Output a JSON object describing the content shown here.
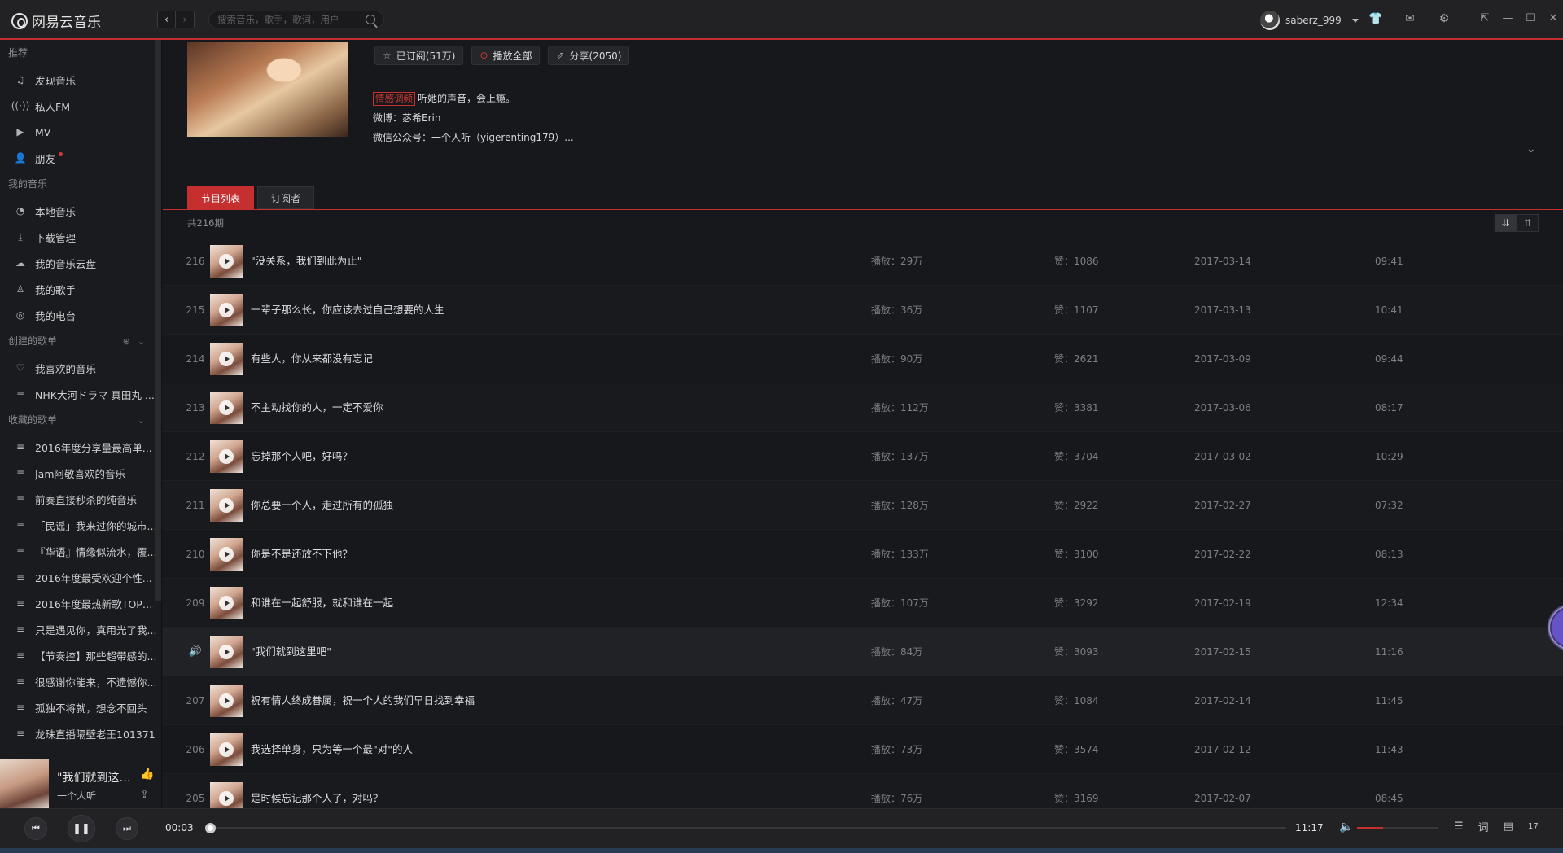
{
  "app": {
    "name": "网易云音乐",
    "search_placeholder": "搜索音乐，歌手，歌词，用户",
    "username": "saberz_999"
  },
  "sidebar": {
    "section_recommend": "推荐",
    "recommend": [
      {
        "label": "发现音乐",
        "icon": "music-note-icon"
      },
      {
        "label": "私人FM",
        "icon": "radio-icon"
      },
      {
        "label": "MV",
        "icon": "mv-icon"
      },
      {
        "label": "朋友",
        "icon": "friends-icon"
      }
    ],
    "section_my_music": "我的音乐",
    "my_music": [
      {
        "label": "本地音乐",
        "icon": "local-music-icon"
      },
      {
        "label": "下载管理",
        "icon": "download-icon"
      },
      {
        "label": "我的音乐云盘",
        "icon": "cloud-icon"
      },
      {
        "label": "我的歌手",
        "icon": "artist-icon"
      },
      {
        "label": "我的电台",
        "icon": "station-icon"
      }
    ],
    "section_created": "创建的歌单",
    "created": [
      {
        "label": "我喜欢的音乐",
        "icon": "heart-icon"
      },
      {
        "label": "NHK大河ドラマ 真田丸 ..."
      }
    ],
    "section_collected": "收藏的歌单",
    "collected": [
      {
        "label": "2016年度分享量最高单..."
      },
      {
        "label": "Jam阿敬喜欢的音乐"
      },
      {
        "label": "前奏直接秒杀的纯音乐"
      },
      {
        "label": "「民谣」我来过你的城市..."
      },
      {
        "label": "『华语』情缘似流水，覆..."
      },
      {
        "label": "2016年度最受欢迎个性..."
      },
      {
        "label": "2016年度最热新歌TOP100"
      },
      {
        "label": "只是遇见你，真用光了我..."
      },
      {
        "label": "【节奏控】那些超带感的..."
      },
      {
        "label": "很感谢你能来，不遗憾你..."
      },
      {
        "label": "孤独不将就，想念不回头"
      },
      {
        "label": "龙珠直播隔壁老王101371"
      }
    ]
  },
  "mini_player": {
    "title": "\"我们就到这里吧\"",
    "artist": "一个人听"
  },
  "header": {
    "subscribe_label": "已订阅(51万)",
    "play_all_label": "播放全部",
    "share_label": "分享(2050)",
    "tag": "情感调频",
    "desc_line1": "听她的声音，会上瘾。",
    "desc_line2": "微博：苾希Erin",
    "desc_line3": "微信公众号：一个人听（yigerenting179）..."
  },
  "tabs": [
    {
      "label": "节目列表",
      "active": true
    },
    {
      "label": "订阅者",
      "active": false
    }
  ],
  "program_count": "共216期",
  "programs": [
    {
      "num": "216",
      "title": "\"没关系，我们到此为止\"",
      "plays": "播放：29万",
      "likes": "赞：1086",
      "date": "2017-03-14",
      "duration": "09:41"
    },
    {
      "num": "215",
      "title": "一辈子那么长，你应该去过自己想要的人生",
      "plays": "播放：36万",
      "likes": "赞：1107",
      "date": "2017-03-13",
      "duration": "10:41"
    },
    {
      "num": "214",
      "title": "有些人，你从来都没有忘记",
      "plays": "播放：90万",
      "likes": "赞：2621",
      "date": "2017-03-09",
      "duration": "09:44"
    },
    {
      "num": "213",
      "title": "不主动找你的人，一定不爱你",
      "plays": "播放：112万",
      "likes": "赞：3381",
      "date": "2017-03-06",
      "duration": "08:17"
    },
    {
      "num": "212",
      "title": "忘掉那个人吧，好吗？",
      "plays": "播放：137万",
      "likes": "赞：3704",
      "date": "2017-03-02",
      "duration": "10:29"
    },
    {
      "num": "211",
      "title": "你总要一个人，走过所有的孤独",
      "plays": "播放：128万",
      "likes": "赞：2922",
      "date": "2017-02-27",
      "duration": "07:32"
    },
    {
      "num": "210",
      "title": "你是不是还放不下他？",
      "plays": "播放：133万",
      "likes": "赞：3100",
      "date": "2017-02-22",
      "duration": "08:13"
    },
    {
      "num": "209",
      "title": "和谁在一起舒服，就和谁在一起",
      "plays": "播放：107万",
      "likes": "赞：3292",
      "date": "2017-02-19",
      "duration": "12:34"
    },
    {
      "num": "",
      "title": "\"我们就到这里吧\"",
      "plays": "播放：84万",
      "likes": "赞：3093",
      "date": "2017-02-15",
      "duration": "11:16",
      "playing": true
    },
    {
      "num": "207",
      "title": "祝有情人终成眷属，祝一个人的我们早日找到幸福",
      "plays": "播放：47万",
      "likes": "赞：1084",
      "date": "2017-02-14",
      "duration": "11:45"
    },
    {
      "num": "206",
      "title": "我选择单身，只为等一个最\"对\"的人",
      "plays": "播放：73万",
      "likes": "赞：3574",
      "date": "2017-02-12",
      "duration": "11:43"
    },
    {
      "num": "205",
      "title": "是时候忘记那个人了，对吗？",
      "plays": "播放：76万",
      "likes": "赞：3169",
      "date": "2017-02-07",
      "duration": "08:45"
    }
  ],
  "player": {
    "current_time": "00:03",
    "total_time": "11:17",
    "progress_fraction": 0.0045,
    "volume_fraction": 0.32,
    "playlist_count": "17"
  },
  "colors": {
    "accent": "#c62f2f",
    "background": "#16181c",
    "sidebar": "#1a1b1e"
  }
}
